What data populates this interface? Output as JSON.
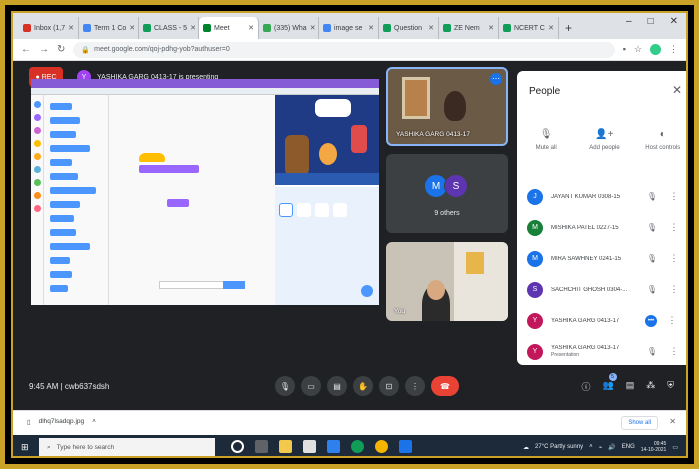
{
  "browser": {
    "tabs": [
      {
        "label": "Inbox (1,7",
        "color": "#d93025"
      },
      {
        "label": "Term 1 Co",
        "color": "#4285f4"
      },
      {
        "label": "CLASS - 5",
        "color": "#0f9d58"
      },
      {
        "label": "Meet",
        "color": "#00832d",
        "active": true
      },
      {
        "label": "(335) Wha",
        "color": "#34a853"
      },
      {
        "label": "image se",
        "color": "#4285f4"
      },
      {
        "label": "Question",
        "color": "#0f9d58"
      },
      {
        "label": "ZE Nem",
        "color": "#0f9d58"
      },
      {
        "label": "NCERT C",
        "color": "#0f9d58"
      }
    ],
    "new_tab": "+",
    "url": "meet.google.com/qoj-pdhg-yob?authuser=0"
  },
  "meet": {
    "rec_label": "REC",
    "presenter_initial": "Y",
    "presenting_text": "YASHIKA GARG 0413-17 is presenting",
    "tiles": {
      "main_label": "YASHIKA GARG 0413-17",
      "others_avatars": [
        {
          "initial": "M",
          "color": "#1a73e8"
        },
        {
          "initial": "S",
          "color": "#5e35b1"
        }
      ],
      "others_label": "9 others",
      "you_label": "You"
    },
    "time": "9:45 AM",
    "meeting_code": "cwb637sdsh",
    "participants_badge": "5"
  },
  "people": {
    "title": "People",
    "actions": [
      {
        "label": "Mute all",
        "icon": "mic-off-icon",
        "glyph": "🎙"
      },
      {
        "label": "Add people",
        "icon": "add-person-icon",
        "glyph": "👤+"
      },
      {
        "label": "Host controls",
        "icon": "toggle-icon",
        "glyph": "◐"
      }
    ],
    "list": [
      {
        "initial": "J",
        "name": "JAYANT KUMAR 0308-15",
        "sub": "",
        "color": "#1a73e8",
        "speaking": false
      },
      {
        "initial": "M",
        "name": "MISHIKA PATEL 0227-15",
        "sub": "",
        "color": "#188038",
        "speaking": false
      },
      {
        "initial": "M",
        "name": "MIRA SAWHNEY 0241-15",
        "sub": "",
        "color": "#1a73e8",
        "speaking": false
      },
      {
        "initial": "S",
        "name": "SACHCHIT GHOSH 0304-...",
        "sub": "",
        "color": "#5e35b1",
        "speaking": false
      },
      {
        "initial": "Y",
        "name": "YASHIKA GARG 0413-17",
        "sub": "",
        "color": "#c2185b",
        "speaking": true
      },
      {
        "initial": "Y",
        "name": "YASHIKA GARG 0413-17",
        "sub": "Presentation",
        "color": "#c2185b",
        "speaking": false
      }
    ]
  },
  "download": {
    "file": "dlhq7lsadqp.jpg",
    "show_all": "Show all"
  },
  "taskbar": {
    "search_placeholder": "Type here to search",
    "weather": "27°C Partly sunny",
    "lang": "ENG",
    "time": "09:45",
    "date": "14-10-2021"
  }
}
